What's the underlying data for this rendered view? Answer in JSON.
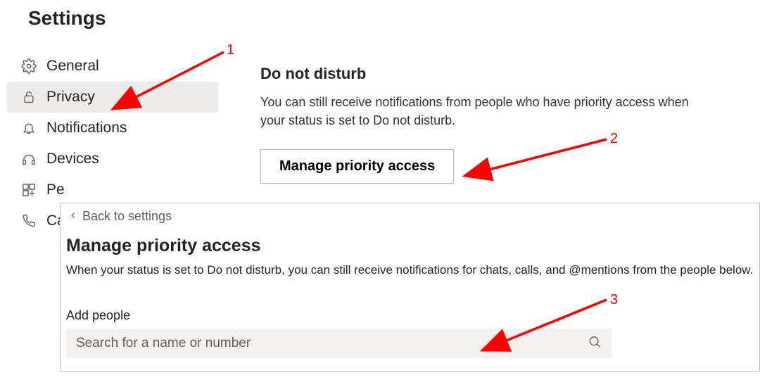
{
  "page_title": "Settings",
  "sidebar": {
    "items": [
      {
        "icon": "gear-icon",
        "label": "General"
      },
      {
        "icon": "lock-icon",
        "label": "Privacy"
      },
      {
        "icon": "bell-icon",
        "label": "Notifications"
      },
      {
        "icon": "devices-icon",
        "label": "Devices"
      },
      {
        "icon": "permissions-icon",
        "label": "Pe"
      },
      {
        "icon": "calls-icon",
        "label": "Ca"
      }
    ],
    "active_index": 1
  },
  "main": {
    "heading": "Do not disturb",
    "description": "You can still receive notifications from people who have priority access when your status is set to Do not disturb.",
    "button_label": "Manage priority access"
  },
  "overlay": {
    "back_label": "Back to settings",
    "title": "Manage priority access",
    "description": "When your status is set to Do not disturb, you can still receive notifications for chats, calls, and @mentions from the people below.",
    "add_people_label": "Add people",
    "search_placeholder": "Search for a name or number"
  },
  "annotations": {
    "one": "1",
    "two": "2",
    "three": "3",
    "color": "#ff0000"
  }
}
